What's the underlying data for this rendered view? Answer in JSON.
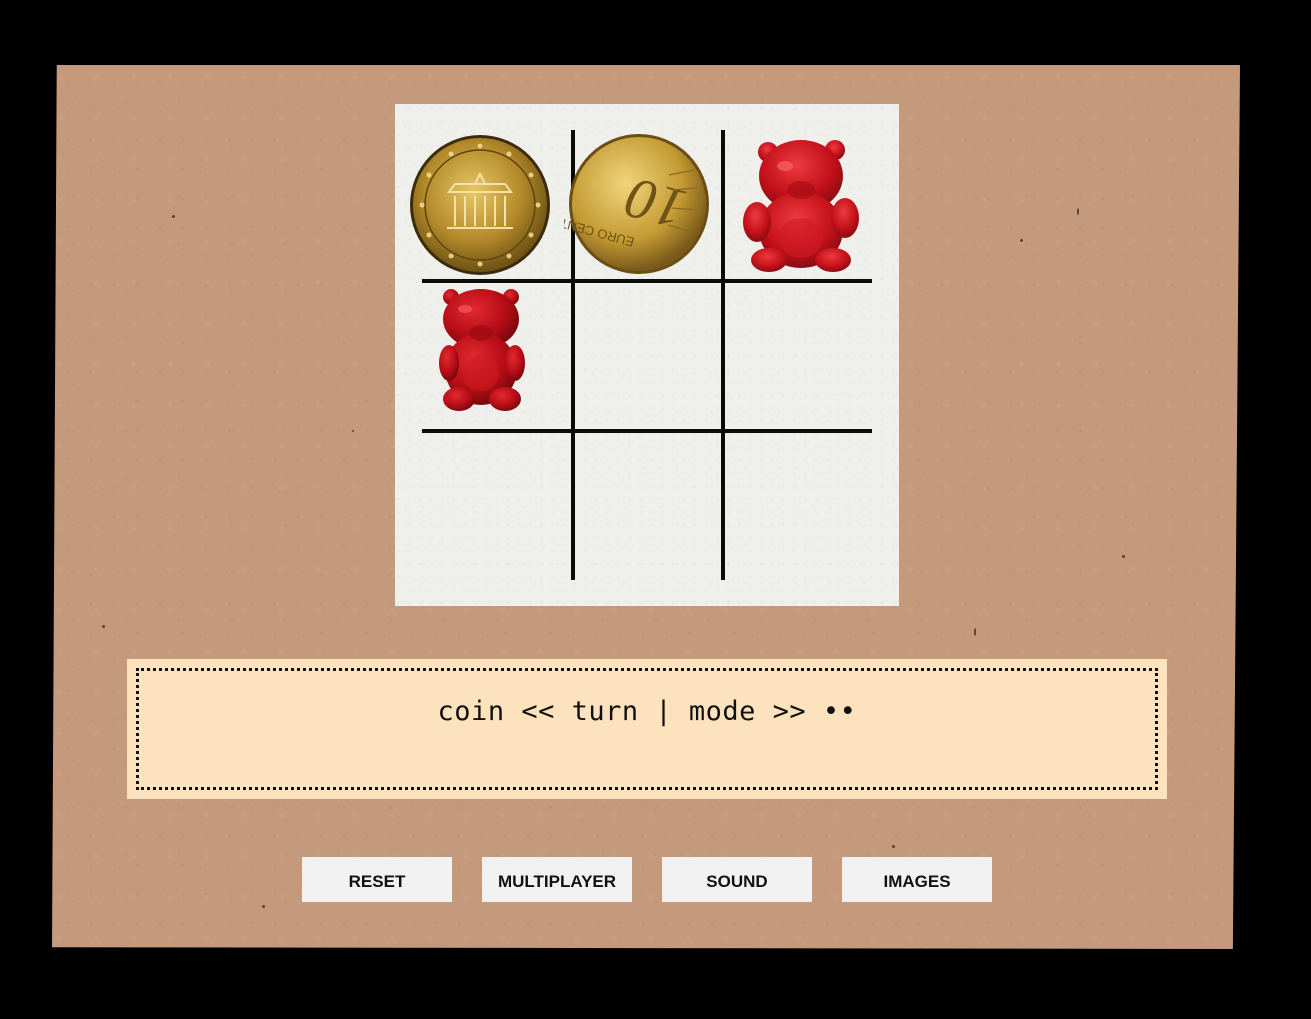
{
  "board": {
    "cells": [
      {
        "row": 0,
        "col": 0,
        "piece": "coin",
        "icon": "gold-euro-coin-icon",
        "detail": "Brandenburg Gate coin"
      },
      {
        "row": 0,
        "col": 1,
        "piece": "coin",
        "icon": "gold-euro-coin-icon",
        "detail": "10 euro cent reverse"
      },
      {
        "row": 0,
        "col": 2,
        "piece": "gummy-bear",
        "icon": "red-gummy-bear-icon"
      },
      {
        "row": 1,
        "col": 0,
        "piece": "gummy-bear",
        "icon": "red-gummy-bear-icon"
      },
      {
        "row": 1,
        "col": 1,
        "piece": null
      },
      {
        "row": 1,
        "col": 2,
        "piece": null
      },
      {
        "row": 2,
        "col": 0,
        "piece": null
      },
      {
        "row": 2,
        "col": 1,
        "piece": null
      },
      {
        "row": 2,
        "col": 2,
        "piece": null
      }
    ],
    "coin_glyph_1": "10",
    "coin_glyph_2": "EURO CENT"
  },
  "status": {
    "text": "coin << turn | mode >> ••"
  },
  "buttons": {
    "reset": "RESET",
    "multiplayer": "MULTIPLAYER",
    "sound": "SOUND",
    "images": "IMAGES"
  },
  "colors": {
    "cardboard": "#c59a7c",
    "paper": "#efefec",
    "status_bg": "#fde3bd",
    "gummy_red": "#c4111a",
    "coin_gold": "#c9a33c"
  }
}
